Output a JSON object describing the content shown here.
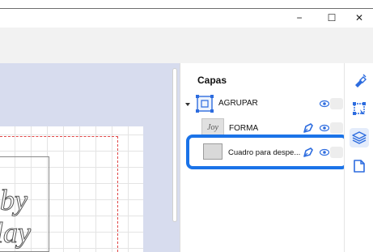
{
  "window": {
    "minimize_glyph": "−",
    "maximize_glyph": "☐",
    "close_glyph": "✕"
  },
  "canvas": {
    "text_line1": "by",
    "text_line2": "lay"
  },
  "layers_panel": {
    "title": "Capas",
    "layers": [
      {
        "name": "AGRUPAR",
        "type": "group",
        "expanded": true
      },
      {
        "name": "FORMA",
        "type": "shape",
        "thumb_text": "Joy"
      },
      {
        "name": "Cuadro para despe...",
        "type": "rectangle",
        "highlighted": true
      }
    ]
  },
  "sidebar": {
    "icons": [
      "paint-icon",
      "transform-icon",
      "layers-icon",
      "page-icon"
    ],
    "active": "layers-icon"
  },
  "colors": {
    "accent": "#1a73e8",
    "pen": "#2d6cdf",
    "canvas_bg": "#d7dcee"
  }
}
